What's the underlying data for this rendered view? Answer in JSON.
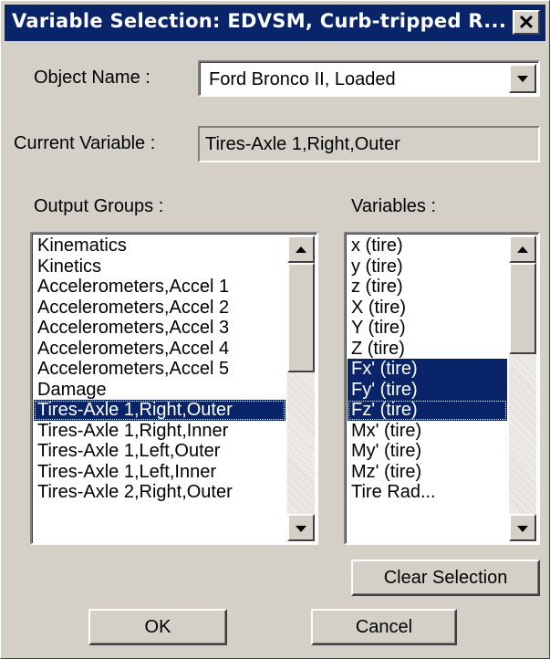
{
  "window": {
    "title": "Variable Selection: EDVSM, Curb-tripped R...",
    "close_glyph": "✕"
  },
  "object_name": {
    "label": "Object Name :",
    "value": "Ford Bronco II, Loaded"
  },
  "current_variable": {
    "label": "Current Variable :",
    "value": "Tires-Axle 1,Right,Outer"
  },
  "output_groups": {
    "label": "Output Groups :",
    "items": [
      {
        "label": "Kinematics",
        "selected": false
      },
      {
        "label": "Kinetics",
        "selected": false
      },
      {
        "label": "Accelerometers,Accel 1",
        "selected": false
      },
      {
        "label": "Accelerometers,Accel 2",
        "selected": false
      },
      {
        "label": "Accelerometers,Accel 3",
        "selected": false
      },
      {
        "label": "Accelerometers,Accel 4",
        "selected": false
      },
      {
        "label": "Accelerometers,Accel 5",
        "selected": false
      },
      {
        "label": "Damage",
        "selected": false
      },
      {
        "label": "Tires-Axle 1,Right,Outer",
        "selected": true
      },
      {
        "label": "Tires-Axle 1,Right,Inner",
        "selected": false
      },
      {
        "label": "Tires-Axle 1,Left,Outer",
        "selected": false
      },
      {
        "label": "Tires-Axle 1,Left,Inner",
        "selected": false
      },
      {
        "label": "Tires-Axle 2,Right,Outer",
        "selected": false
      }
    ]
  },
  "variables": {
    "label": "Variables :",
    "items": [
      {
        "label": "x (tire)",
        "selected": false
      },
      {
        "label": "y (tire)",
        "selected": false
      },
      {
        "label": "z (tire)",
        "selected": false
      },
      {
        "label": "X (tire)",
        "selected": false
      },
      {
        "label": "Y (tire)",
        "selected": false
      },
      {
        "label": "Z (tire)",
        "selected": false
      },
      {
        "label": "Fx' (tire)",
        "selected": true
      },
      {
        "label": "Fy' (tire)",
        "selected": true
      },
      {
        "label": "Fz' (tire)",
        "selected": true
      },
      {
        "label": "Mx' (tire)",
        "selected": false
      },
      {
        "label": "My' (tire)",
        "selected": false
      },
      {
        "label": "Mz' (tire)",
        "selected": false
      },
      {
        "label": "Tire Rad...",
        "selected": false
      }
    ]
  },
  "buttons": {
    "clear_selection": "Clear Selection",
    "ok": "OK",
    "cancel": "Cancel"
  },
  "icons": {
    "close": "close-icon",
    "dropdown": "chevron-down-icon",
    "scroll_up": "scroll-up-icon",
    "scroll_down": "scroll-down-icon"
  },
  "colors": {
    "face": "#d4d0c8",
    "title_bar": "#0a246a",
    "selection": "#0a246a"
  }
}
